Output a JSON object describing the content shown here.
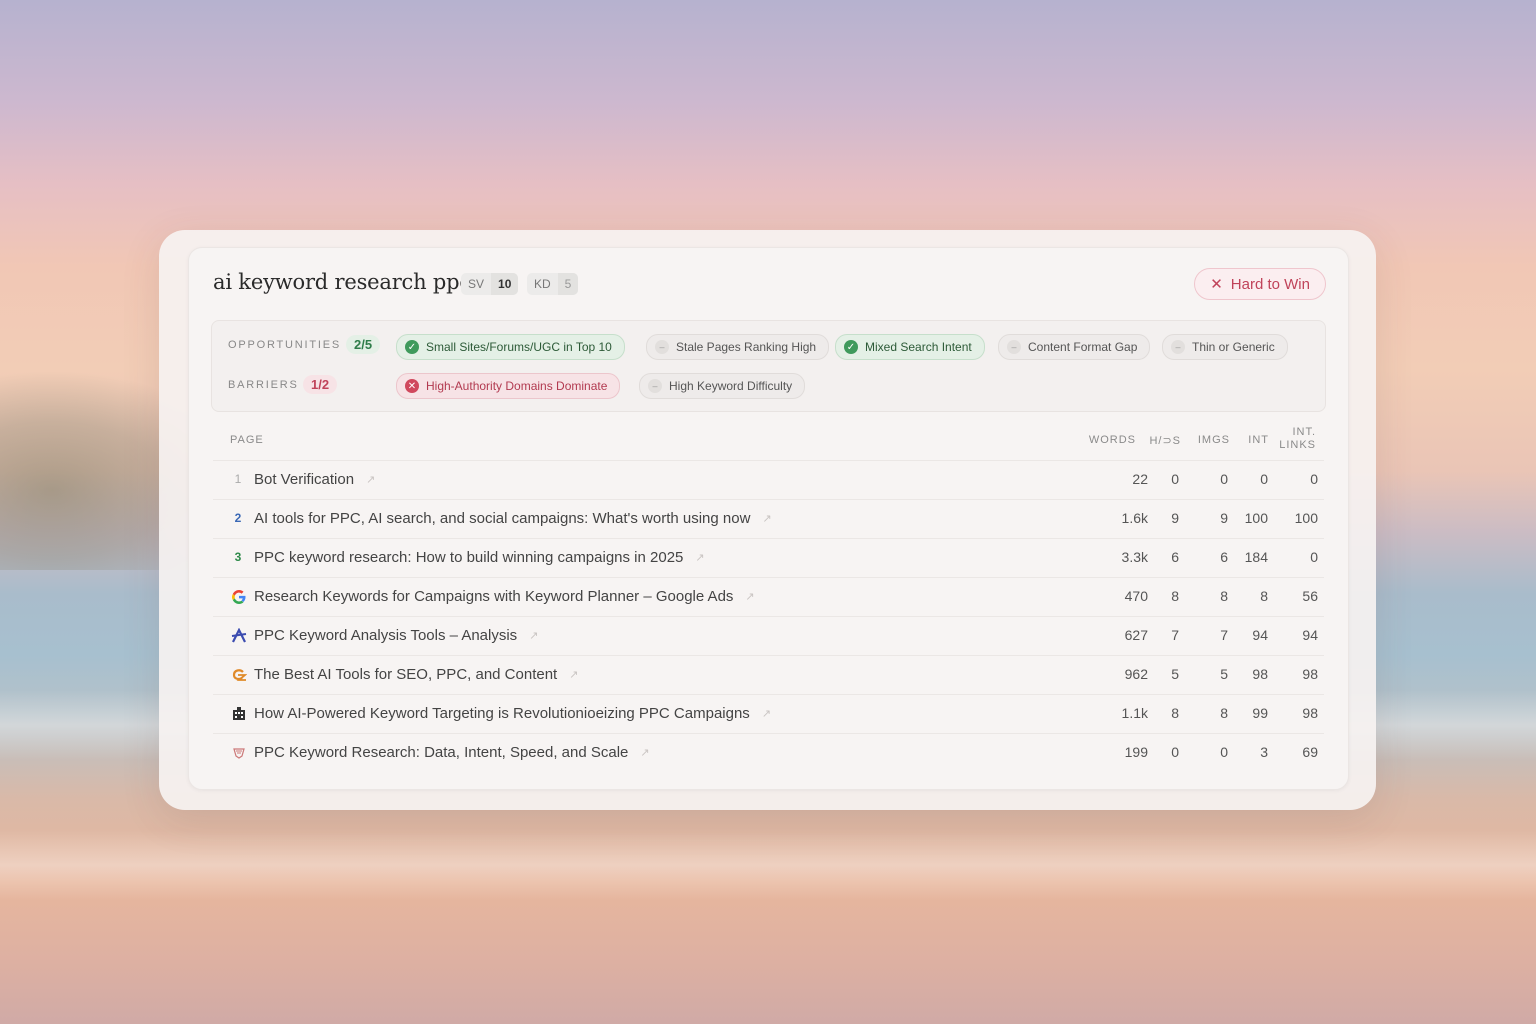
{
  "keyword": "ai keyword research ppc",
  "metrics": {
    "sv_label": "SV",
    "sv_value": "10",
    "kd_label": "KD",
    "kd_value": "5"
  },
  "verdict": {
    "icon": "close-icon",
    "label": "Hard to Win",
    "color": "#c0435a"
  },
  "opportunities": {
    "label": "OPPORTUNITIES",
    "count": "2/5",
    "items": [
      {
        "label": "Small Sites/Forums/UGC in Top 10",
        "status": "met"
      },
      {
        "label": "Stale Pages Ranking High",
        "status": "unmet"
      },
      {
        "label": "Mixed Search Intent",
        "status": "met"
      },
      {
        "label": "Content Format Gap",
        "status": "unmet"
      },
      {
        "label": "Thin or Generic",
        "status": "unmet"
      }
    ]
  },
  "barriers": {
    "label": "BARRIERS",
    "count": "1/2",
    "items": [
      {
        "label": "High-Authority Domains Dominate",
        "status": "met"
      },
      {
        "label": "High Keyword Difficulty",
        "status": "unmet"
      }
    ]
  },
  "table": {
    "columns": {
      "page": "PAGE",
      "words": "WORDS",
      "hdrs": "H/⊃S",
      "imgs": "IMGS",
      "int": "INT",
      "int_links_1": "INT.",
      "int_links_2": "LINKS"
    },
    "rows": [
      {
        "rank": "1",
        "title": "Bot Verification",
        "words": "22",
        "h": "0",
        "imgs": "0",
        "int": "0",
        "links": "0"
      },
      {
        "rank": "2",
        "title": "AI tools for PPC, AI search, and social campaigns: What's worth using now",
        "words": "1.6k",
        "h": "9",
        "imgs": "9",
        "int": "100",
        "links": "100"
      },
      {
        "rank": "3",
        "title": "PPC keyword research: How to build winning campaigns in 2025",
        "words": "3.3k",
        "h": "6",
        "imgs": "6",
        "int": "184",
        "links": "0"
      },
      {
        "favicon": "google-icon",
        "title": "Research Keywords for Campaigns with Keyword Planner – Google Ads",
        "words": "470",
        "h": "8",
        "imgs": "8",
        "int": "8",
        "links": "56"
      },
      {
        "favicon": "analysis-logo-icon",
        "title": "PPC Keyword Analysis Tools – Analysis",
        "words": "627",
        "h": "7",
        "imgs": "7",
        "int": "94",
        "links": "94"
      },
      {
        "favicon": "seo-tool-logo-icon",
        "title": "The Best AI Tools for SEO, PPC, and Content",
        "words": "962",
        "h": "5",
        "imgs": "5",
        "int": "98",
        "links": "98"
      },
      {
        "favicon": "building-logo-icon",
        "title": "How AI-Powered Keyword Targeting is Revolutionioeizing PPC Campaigns",
        "words": "1.1k",
        "h": "8",
        "imgs": "8",
        "int": "99",
        "links": "98"
      },
      {
        "favicon": "shield-logo-icon",
        "title": "PPC Keyword Research: Data, Intent, Speed, and Scale",
        "words": "199",
        "h": "0",
        "imgs": "0",
        "int": "3",
        "links": "69"
      }
    ]
  }
}
